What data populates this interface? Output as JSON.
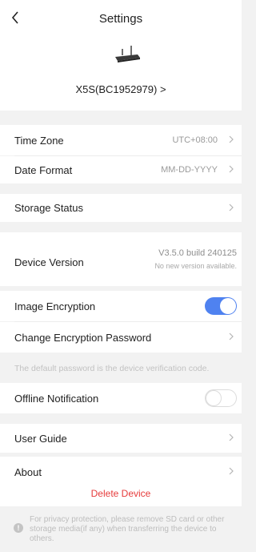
{
  "header": {
    "back_icon": "chevron-left-icon",
    "title": "Settings",
    "device_name": "X5S(BC1952979) >"
  },
  "time_zone": {
    "label": "Time Zone",
    "value": "UTC+08:00"
  },
  "date_format": {
    "label": "Date Format",
    "value": "MM-DD-YYYY"
  },
  "storage_status": {
    "label": "Storage Status"
  },
  "device_version": {
    "label": "Device Version",
    "value": "V3.5.0 build 240125",
    "note": "No new version available."
  },
  "image_encryption": {
    "label": "Image Encryption",
    "enabled": true
  },
  "change_password": {
    "label": "Change Encryption Password",
    "hint": "The default password is the device verification code."
  },
  "offline_notification": {
    "label": "Offline Notification",
    "enabled": false
  },
  "user_guide": {
    "label": "User Guide"
  },
  "about": {
    "label": "About"
  },
  "delete_device": {
    "label": "Delete Device",
    "color": "#e63b3b"
  },
  "notice": {
    "icon": "exclamation-icon",
    "text": "For privacy protection, please remove SD card or other storage media(if any) when transferring the device to others."
  },
  "colors": {
    "accent": "#4f82f0",
    "danger": "#e63b3b",
    "background": "#f2f2f2"
  }
}
